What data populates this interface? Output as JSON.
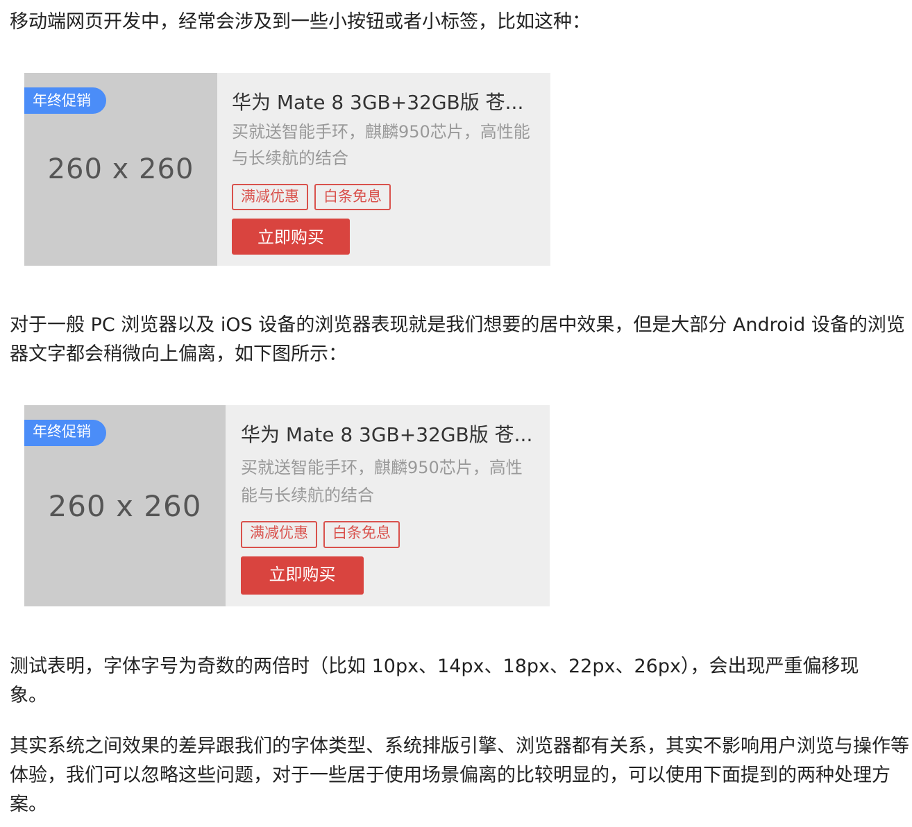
{
  "paragraphs": {
    "intro": "移动端网页开发中，经常会涉及到一些小按钮或者小标签，比如这种：",
    "comparison": "对于一般 PC 浏览器以及 iOS 设备的浏览器表现就是我们想要的居中效果，但是大部分 Android 设备的浏览器文字都会稍微向上偏离，如下图所示：",
    "test_result": "测试表明，字体字号为奇数的两倍时（比如 10px、14px、18px、22px、26px），会出现严重偏移现象。",
    "conclusion": "其实系统之间效果的差异跟我们的字体类型、系统排版引擎、浏览器都有关系，其实不影响用户浏览与操作等体验，我们可以忽略这些问题，对于一些居于使用场景偏离的比较明显的，可以使用下面提到的两种处理方案。"
  },
  "cards": [
    {
      "image_placeholder": "260 x 260",
      "promo_badge": "年终促销",
      "title": "华为 Mate 8 3GB+32GB版 苍...",
      "description": "买就送智能手环，麒麟950芯片，高性能与长续航的结合",
      "tags": [
        "满减优惠",
        "白条免息"
      ],
      "buy_button": "立即购买"
    },
    {
      "image_placeholder": "260 x 260",
      "promo_badge": "年终促销",
      "title": "华为 Mate 8 3GB+32GB版 苍...",
      "description": "买就送智能手环，麒麟950芯片，高性能与长续航的结合",
      "tags": [
        "满减优惠",
        "白条免息"
      ],
      "buy_button": "立即购买"
    }
  ],
  "colors": {
    "promo_badge_bg": "#4b8df8",
    "tag_border": "#d9514c",
    "buy_button_bg": "#d9443f",
    "card_bg": "#eeeeee",
    "thumb_bg": "#cccccc"
  }
}
